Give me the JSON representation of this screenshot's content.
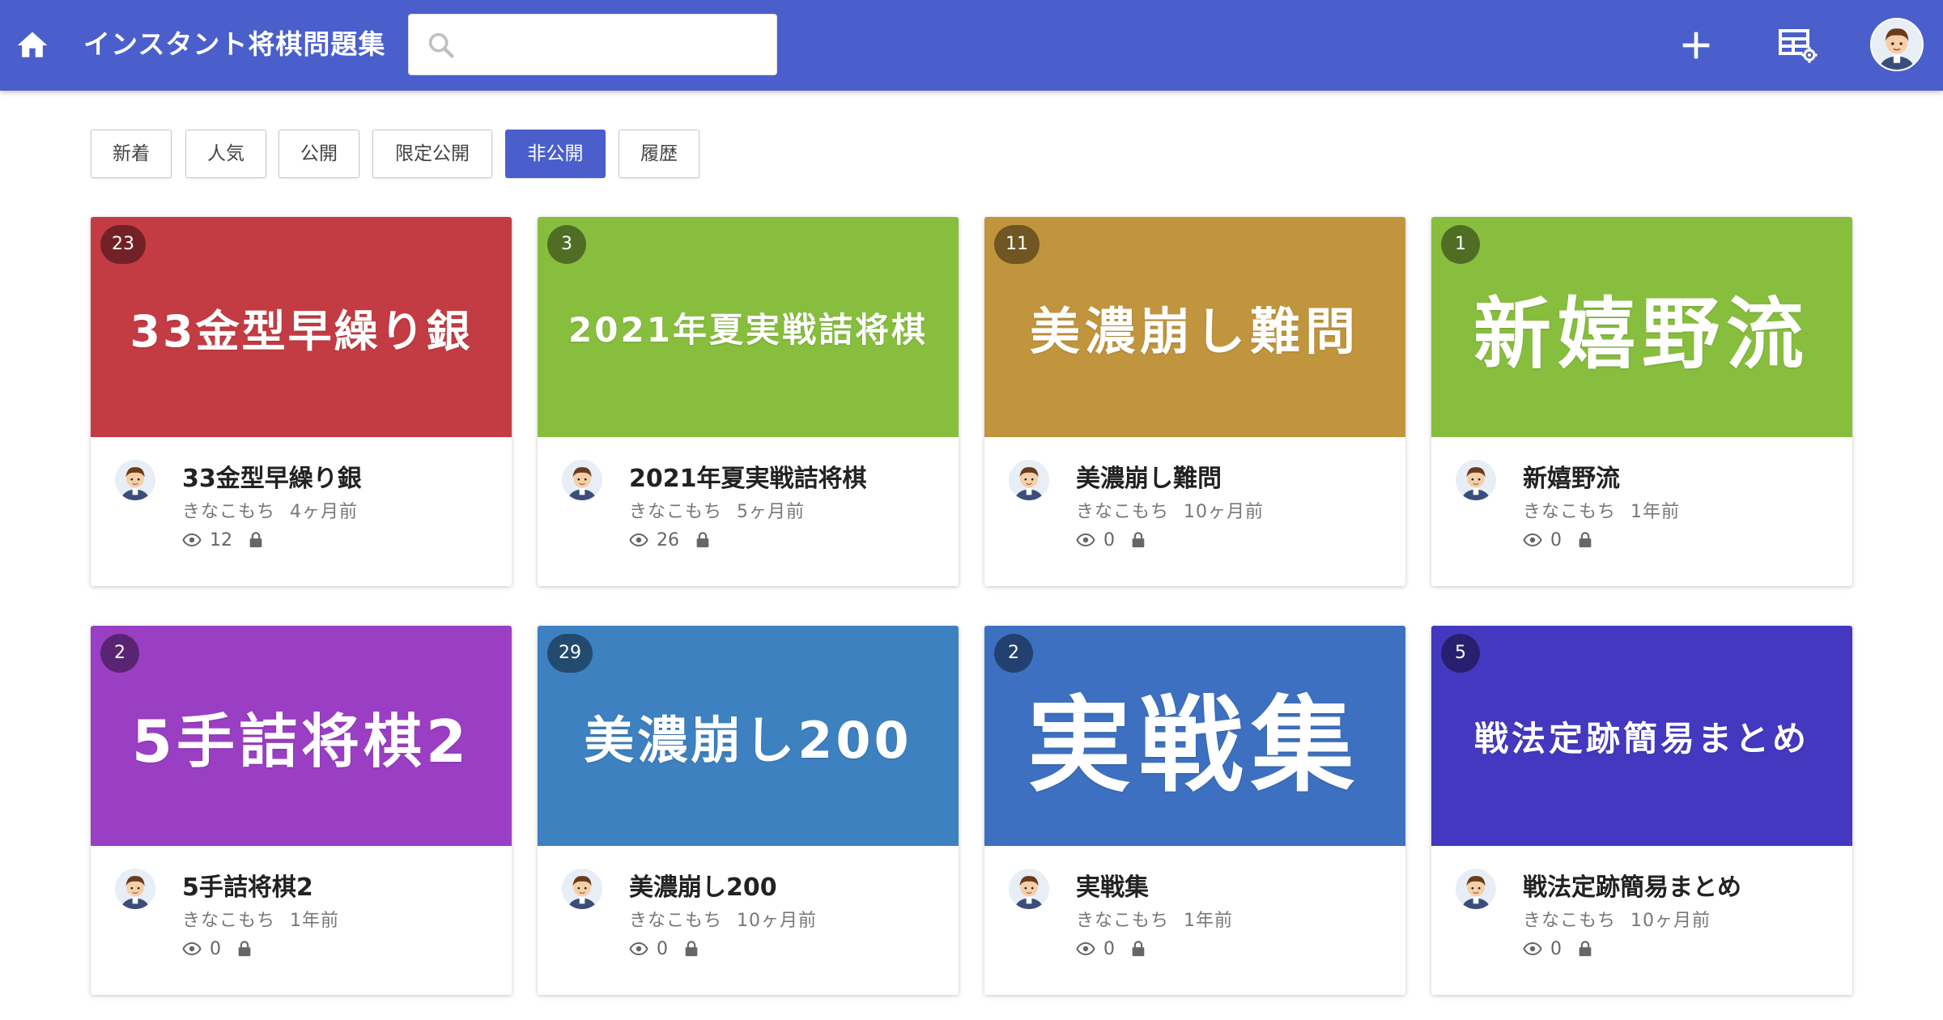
{
  "header": {
    "title": "インスタント将棋問題集",
    "search": {
      "placeholder": "",
      "value": ""
    },
    "bg_color": "#4a5fcc",
    "icons": [
      "home-icon",
      "search-icon",
      "plus-icon",
      "table-settings-icon",
      "user-avatar"
    ]
  },
  "tabs": [
    {
      "label": "新着",
      "active": false
    },
    {
      "label": "人気",
      "active": false
    },
    {
      "label": "公開",
      "active": false
    },
    {
      "label": "限定公開",
      "active": false
    },
    {
      "label": "非公開",
      "active": true
    },
    {
      "label": "履歴",
      "active": false
    }
  ],
  "cards": [
    {
      "count": "23",
      "banner": "33金型早繰り銀",
      "color": "#c43c43",
      "title": "33金型早繰り銀",
      "author": "きなこもち",
      "time": "4ヶ月前",
      "views": "12"
    },
    {
      "count": "3",
      "banner": "2021年夏実戦詰将棋",
      "color": "#88be3e",
      "title": "2021年夏実戦詰将棋",
      "author": "きなこもち",
      "time": "5ヶ月前",
      "views": "26"
    },
    {
      "count": "11",
      "banner": "美濃崩し難問",
      "color": "#c1953d",
      "title": "美濃崩し難問",
      "author": "きなこもち",
      "time": "10ヶ月前",
      "views": "0"
    },
    {
      "count": "1",
      "banner": "新嬉野流",
      "color": "#88be3e",
      "title": "新嬉野流",
      "author": "きなこもち",
      "time": "1年前",
      "views": "0"
    },
    {
      "count": "2",
      "banner": "5手詰将棋2",
      "color": "#9a3fc4",
      "title": "5手詰将棋2",
      "author": "きなこもち",
      "time": "1年前",
      "views": "0"
    },
    {
      "count": "29",
      "banner": "美濃崩し200",
      "color": "#3d81c0",
      "title": "美濃崩し200",
      "author": "きなこもち",
      "time": "10ヶ月前",
      "views": "0"
    },
    {
      "count": "2",
      "banner": "実戦集",
      "color": "#3d70c0",
      "title": "実戦集",
      "author": "きなこもち",
      "time": "1年前",
      "views": "0"
    },
    {
      "count": "5",
      "banner": "戦法定跡簡易まとめ",
      "color": "#4538c0",
      "title": "戦法定跡簡易まとめ",
      "author": "きなこもち",
      "time": "10ヶ月前",
      "views": "0"
    }
  ]
}
